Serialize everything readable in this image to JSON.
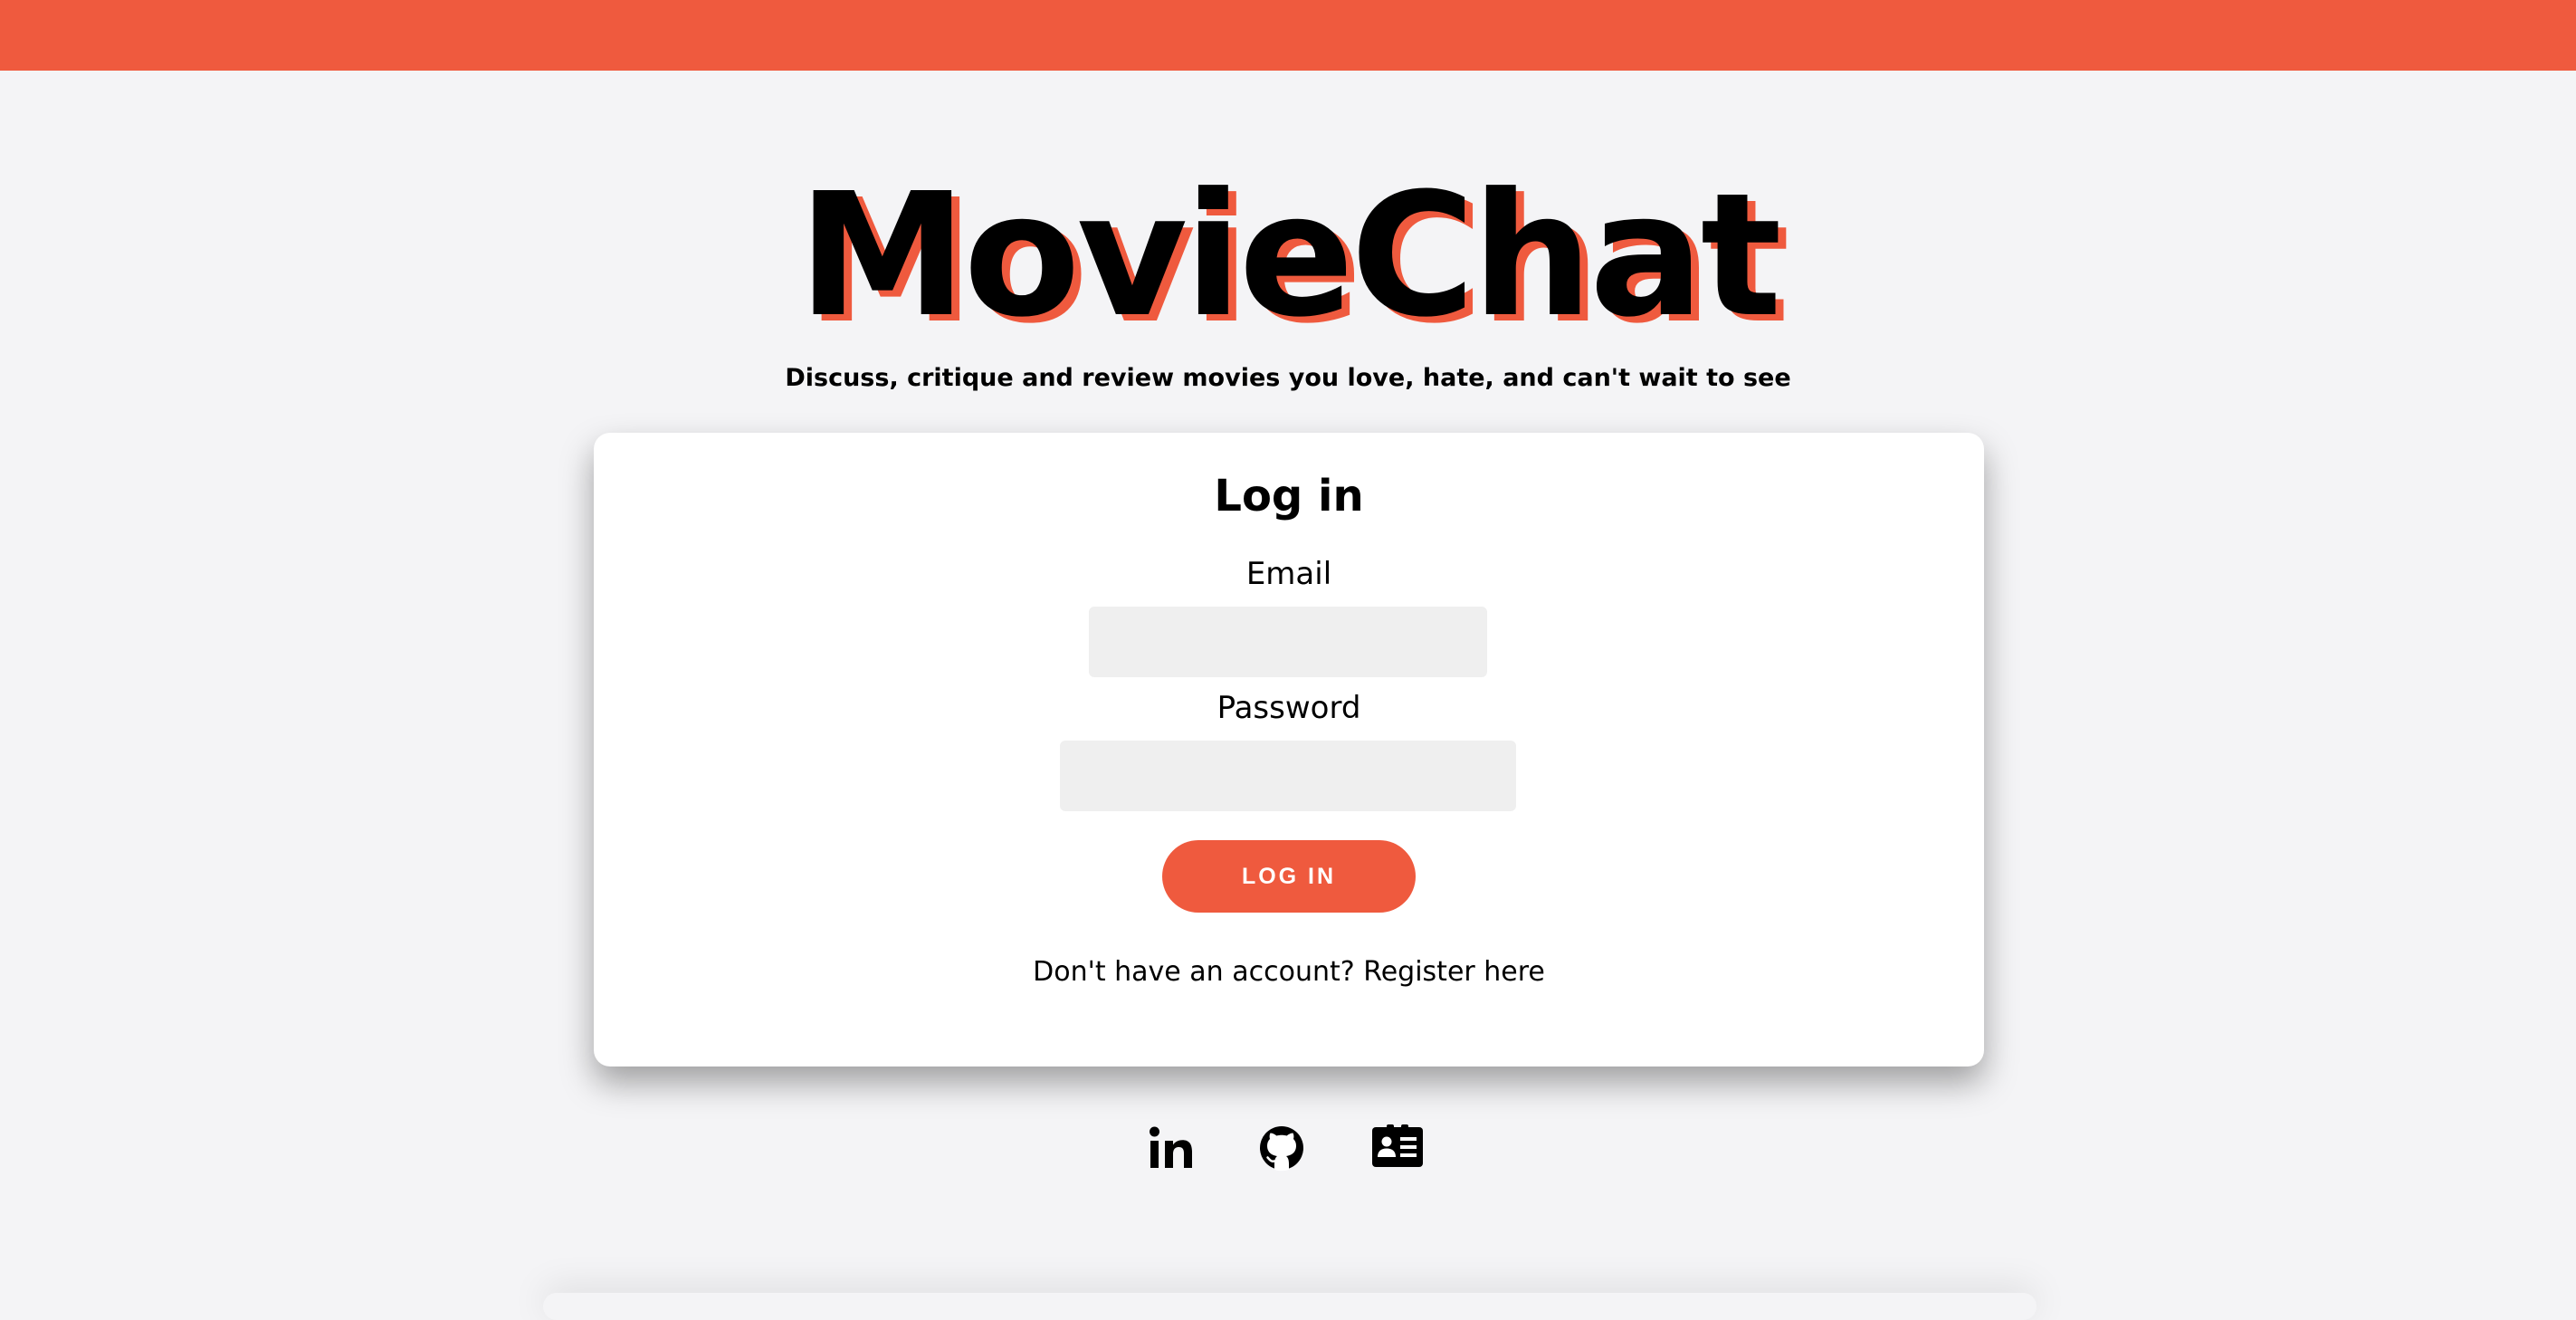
{
  "header": {
    "accent_color": "#ef5a3e"
  },
  "hero": {
    "title": "MovieChat",
    "tagline": "Discuss, critique and review movies you love, hate, and can't wait to see"
  },
  "login": {
    "heading": "Log in",
    "email_label": "Email",
    "email_value": "",
    "password_label": "Password",
    "password_value": "",
    "submit_label": "LOG IN",
    "register_prompt": "Don't have an account?",
    "register_link": "Register here"
  },
  "social": {
    "icons": [
      "linkedin-icon",
      "github-icon",
      "contact-card-icon"
    ]
  }
}
